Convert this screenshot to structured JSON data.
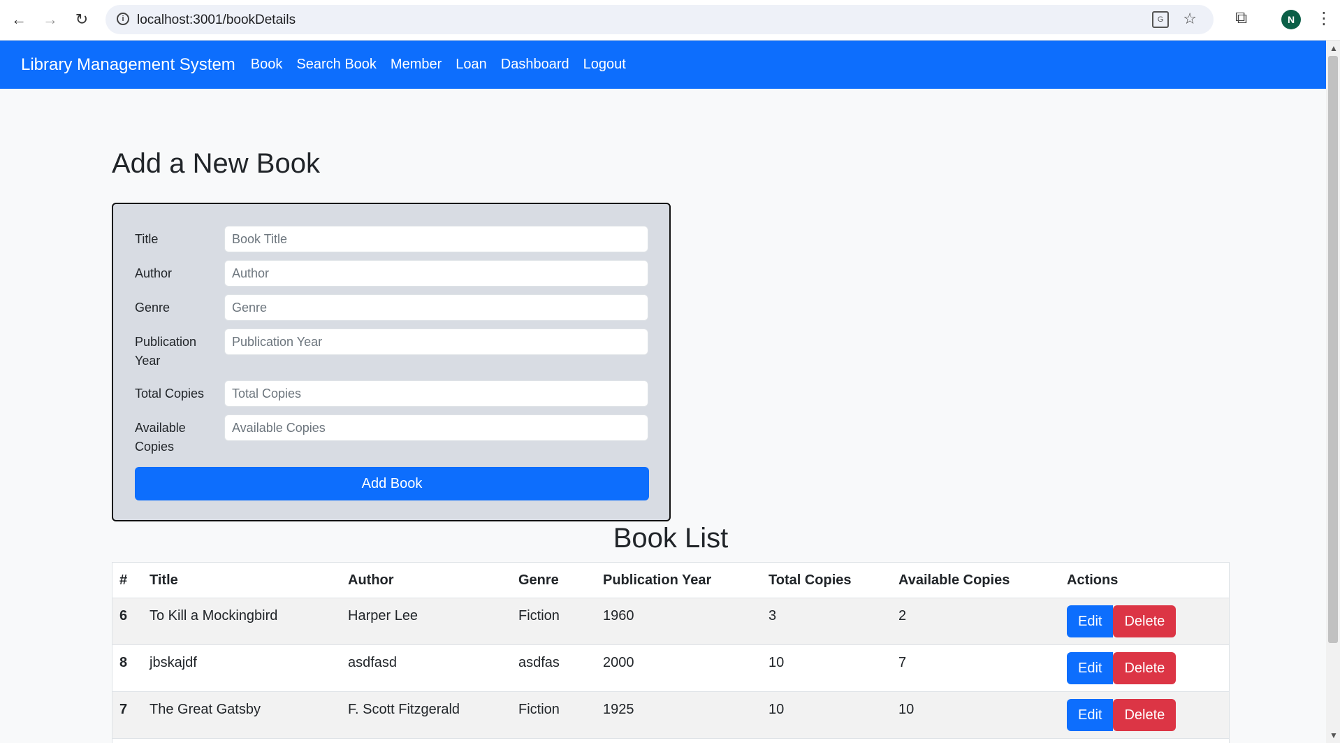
{
  "browser": {
    "url": "localhost:3001/bookDetails",
    "avatar_letter": "N",
    "translate_icon_text": "G"
  },
  "navbar": {
    "brand": "Library Management System",
    "links": [
      "Book",
      "Search Book",
      "Member",
      "Loan",
      "Dashboard",
      "Logout"
    ]
  },
  "form": {
    "heading": "Add a New Book",
    "fields": [
      {
        "label": "Title",
        "placeholder": "Book Title",
        "value": ""
      },
      {
        "label": "Author",
        "placeholder": "Author",
        "value": ""
      },
      {
        "label": "Genre",
        "placeholder": "Genre",
        "value": ""
      },
      {
        "label": "Publication Year",
        "placeholder": "Publication Year",
        "value": ""
      },
      {
        "label": "Total Copies",
        "placeholder": "Total Copies",
        "value": ""
      },
      {
        "label": "Available Copies",
        "placeholder": "Available Copies",
        "value": ""
      }
    ],
    "submit_label": "Add Book"
  },
  "book_list": {
    "heading": "Book List",
    "columns": [
      "#",
      "Title",
      "Author",
      "Genre",
      "Publication Year",
      "Total Copies",
      "Available Copies",
      "Actions"
    ],
    "rows": [
      {
        "id": "6",
        "title": "To Kill a Mockingbird",
        "author": "Harper Lee",
        "genre": "Fiction",
        "year": "1960",
        "total": "3",
        "available": "2"
      },
      {
        "id": "8",
        "title": "jbskajdf",
        "author": "asdfasd",
        "genre": "asdfas",
        "year": "2000",
        "total": "10",
        "available": "7"
      },
      {
        "id": "7",
        "title": "The Great Gatsby",
        "author": "F. Scott Fitzgerald",
        "genre": "Fiction",
        "year": "1925",
        "total": "10",
        "available": "10"
      }
    ],
    "edit_label": "Edit",
    "delete_label": "Delete"
  },
  "colors": {
    "primary": "#0d6efd",
    "danger": "#dc3545",
    "form_bg": "#d8dce3",
    "page_bg": "#f8f9fa"
  }
}
